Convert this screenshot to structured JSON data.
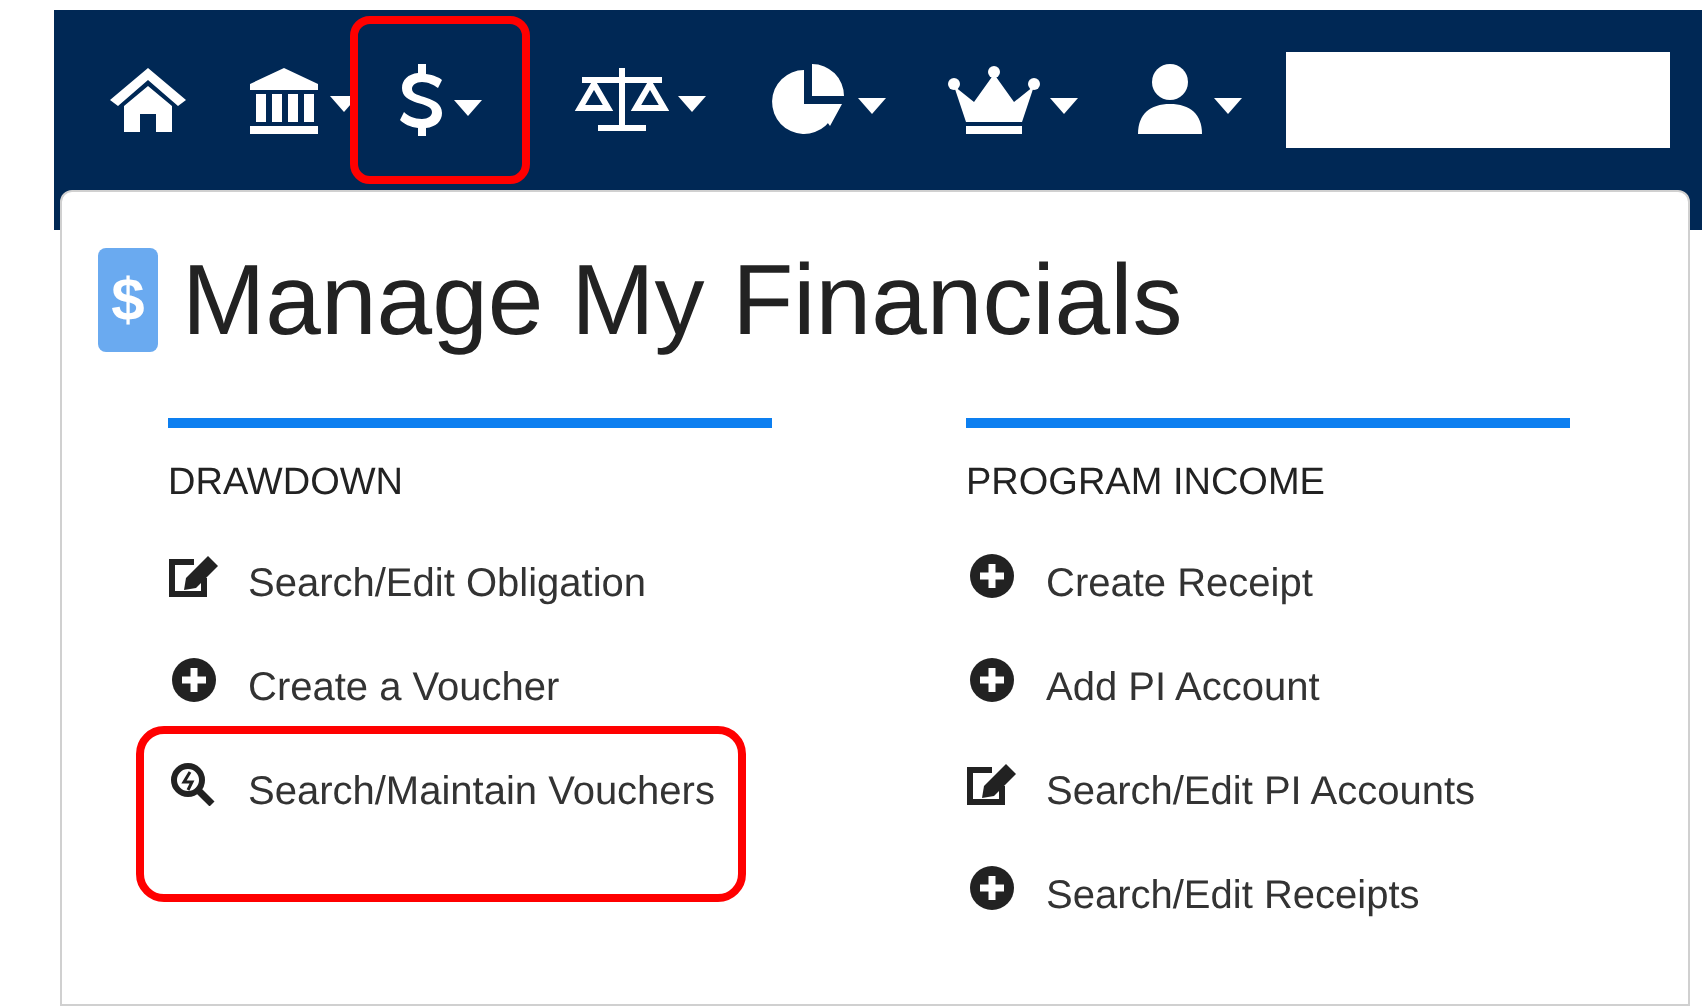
{
  "navbar": {
    "items": [
      {
        "kind": "home",
        "dropdown": false,
        "highlighted": false
      },
      {
        "kind": "bank",
        "dropdown": true,
        "highlighted": false
      },
      {
        "kind": "dollar",
        "dropdown": true,
        "highlighted": true
      },
      {
        "kind": "scales",
        "dropdown": true,
        "highlighted": false
      },
      {
        "kind": "pie",
        "dropdown": true,
        "highlighted": false
      },
      {
        "kind": "crown",
        "dropdown": true,
        "highlighted": false
      },
      {
        "kind": "user",
        "dropdown": true,
        "highlighted": false
      }
    ]
  },
  "menu": {
    "title": "Manage My Financials",
    "badge": "$",
    "sections": [
      {
        "heading": "DRAWDOWN",
        "items": [
          {
            "kind": "edit",
            "label": "Search/Edit Obligation",
            "highlighted": false
          },
          {
            "kind": "plus",
            "label": "Create a Voucher",
            "highlighted": false
          },
          {
            "kind": "search",
            "label": "Search/Maintain Vouchers",
            "highlighted": true
          }
        ]
      },
      {
        "heading": "PROGRAM INCOME",
        "items": [
          {
            "kind": "plus",
            "label": "Create Receipt",
            "highlighted": false
          },
          {
            "kind": "plus",
            "label": "Add PI Account",
            "highlighted": false
          },
          {
            "kind": "edit",
            "label": "Search/Edit PI Accounts",
            "highlighted": false
          },
          {
            "kind": "plus",
            "label": "Search/Edit Receipts",
            "highlighted": false
          }
        ]
      }
    ]
  }
}
